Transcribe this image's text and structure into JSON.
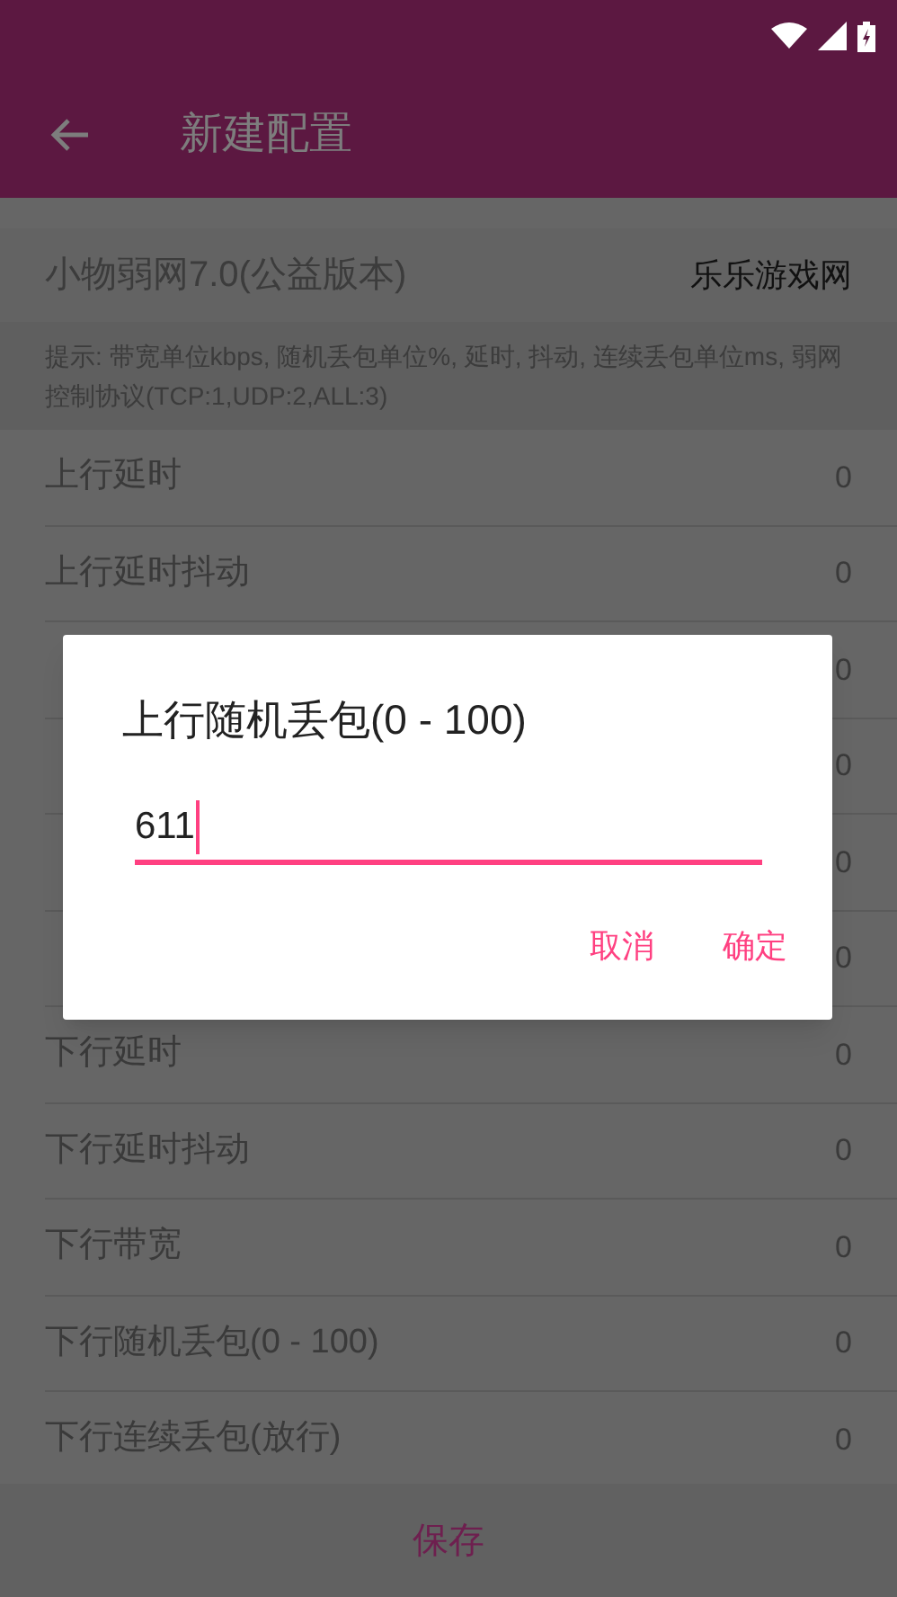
{
  "app_bar": {
    "title": "新建配置"
  },
  "header": {
    "title": "小物弱网7.0(公益版本)",
    "site": "乐乐游戏网"
  },
  "hint": "提示: 带宽单位kbps, 随机丢包单位%, 延时, 抖动, 连续丢包单位ms, 弱网控制协议(TCP:1,UDP:2,ALL:3)",
  "settings": [
    {
      "label": "上行延时",
      "value": "0"
    },
    {
      "label": "上行延时抖动",
      "value": "0"
    },
    {
      "value": "0"
    },
    {
      "value": "0"
    },
    {
      "value": "0"
    },
    {
      "value": "0"
    },
    {
      "label": "下行延时",
      "value": "0"
    },
    {
      "label": "下行延时抖动",
      "value": "0"
    },
    {
      "label": "下行带宽",
      "value": "0"
    },
    {
      "label": "下行随机丢包(0 - 100)",
      "value": "0"
    },
    {
      "label": "下行连续丢包(放行)",
      "value": "0"
    }
  ],
  "save_button": "保存",
  "dialog": {
    "title": "上行随机丢包(0 - 100)",
    "input_value": "611",
    "buttons": [
      "取消",
      "确定"
    ]
  }
}
